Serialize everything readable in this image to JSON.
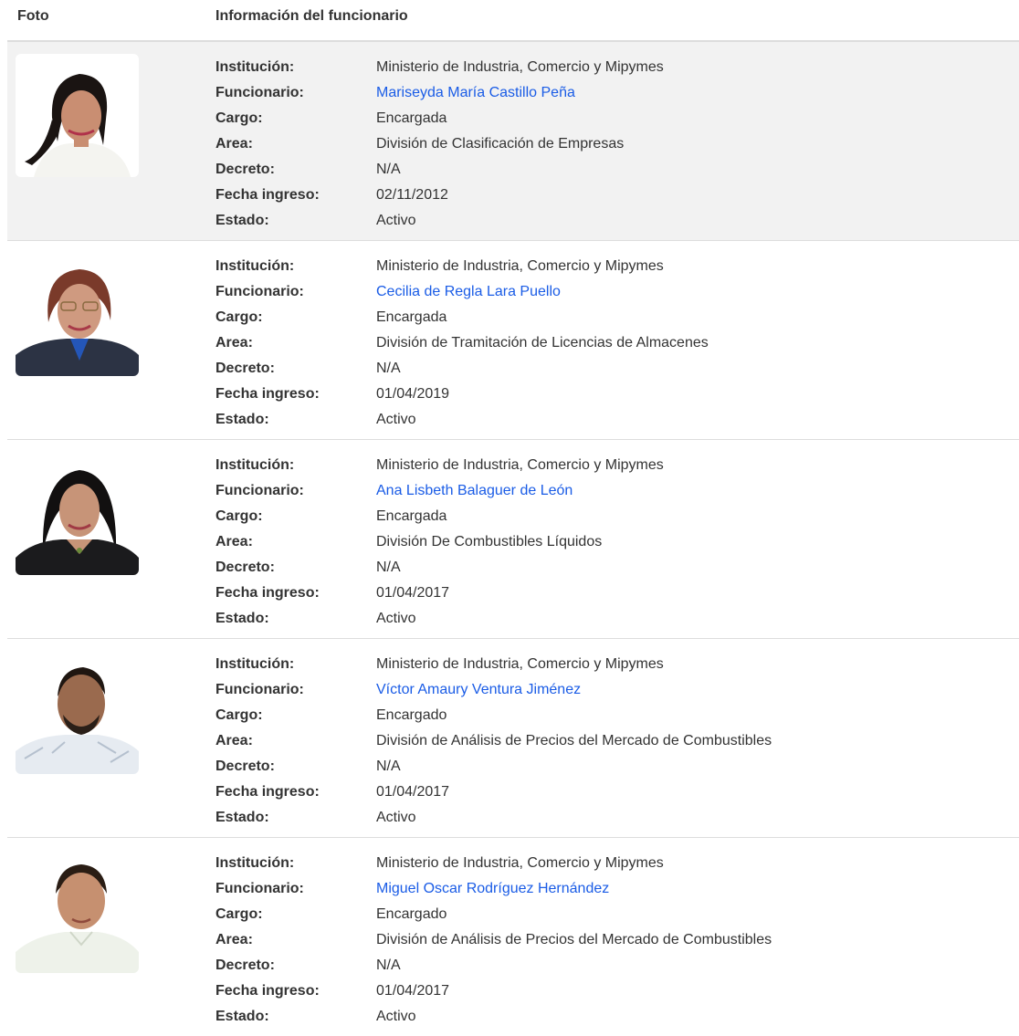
{
  "header": {
    "foto": "Foto",
    "info": "Información del funcionario"
  },
  "labels": {
    "institucion": "Institución:",
    "funcionario": "Funcionario:",
    "cargo": "Cargo:",
    "area": "Area:",
    "decreto": "Decreto:",
    "fecha_ingreso": "Fecha ingreso:",
    "estado": "Estado:"
  },
  "colors": {
    "link": "#1a5ce6",
    "row_highlight": "#f2f2f2"
  },
  "rows": [
    {
      "institucion": "Ministerio de Industria, Comercio y Mipymes",
      "funcionario": "Mariseyda María Castillo Peña",
      "cargo": "Encargada",
      "area": "División de Clasificación de Empresas",
      "decreto": "N/A",
      "fecha_ingreso": "02/11/2012",
      "estado": "Activo"
    },
    {
      "institucion": "Ministerio de Industria, Comercio y Mipymes",
      "funcionario": "Cecilia de Regla Lara Puello",
      "cargo": "Encargada",
      "area": "División de Tramitación de Licencias de Almacenes",
      "decreto": "N/A",
      "fecha_ingreso": "01/04/2019",
      "estado": "Activo"
    },
    {
      "institucion": "Ministerio de Industria, Comercio y Mipymes",
      "funcionario": "Ana Lisbeth Balaguer de León",
      "cargo": "Encargada",
      "area": "División De Combustibles Líquidos",
      "decreto": "N/A",
      "fecha_ingreso": "01/04/2017",
      "estado": "Activo"
    },
    {
      "institucion": "Ministerio de Industria, Comercio y Mipymes",
      "funcionario": "Víctor Amaury Ventura Jiménez",
      "cargo": "Encargado",
      "area": "División de Análisis de Precios del Mercado de Combustibles",
      "decreto": "N/A",
      "fecha_ingreso": "01/04/2017",
      "estado": "Activo"
    },
    {
      "institucion": "Ministerio de Industria, Comercio y Mipymes",
      "funcionario": "Miguel Oscar Rodríguez Hernández",
      "cargo": "Encargado",
      "area": "División de Análisis de Precios del Mercado de Combustibles",
      "decreto": "N/A",
      "fecha_ingreso": "01/04/2017",
      "estado": "Activo"
    }
  ]
}
